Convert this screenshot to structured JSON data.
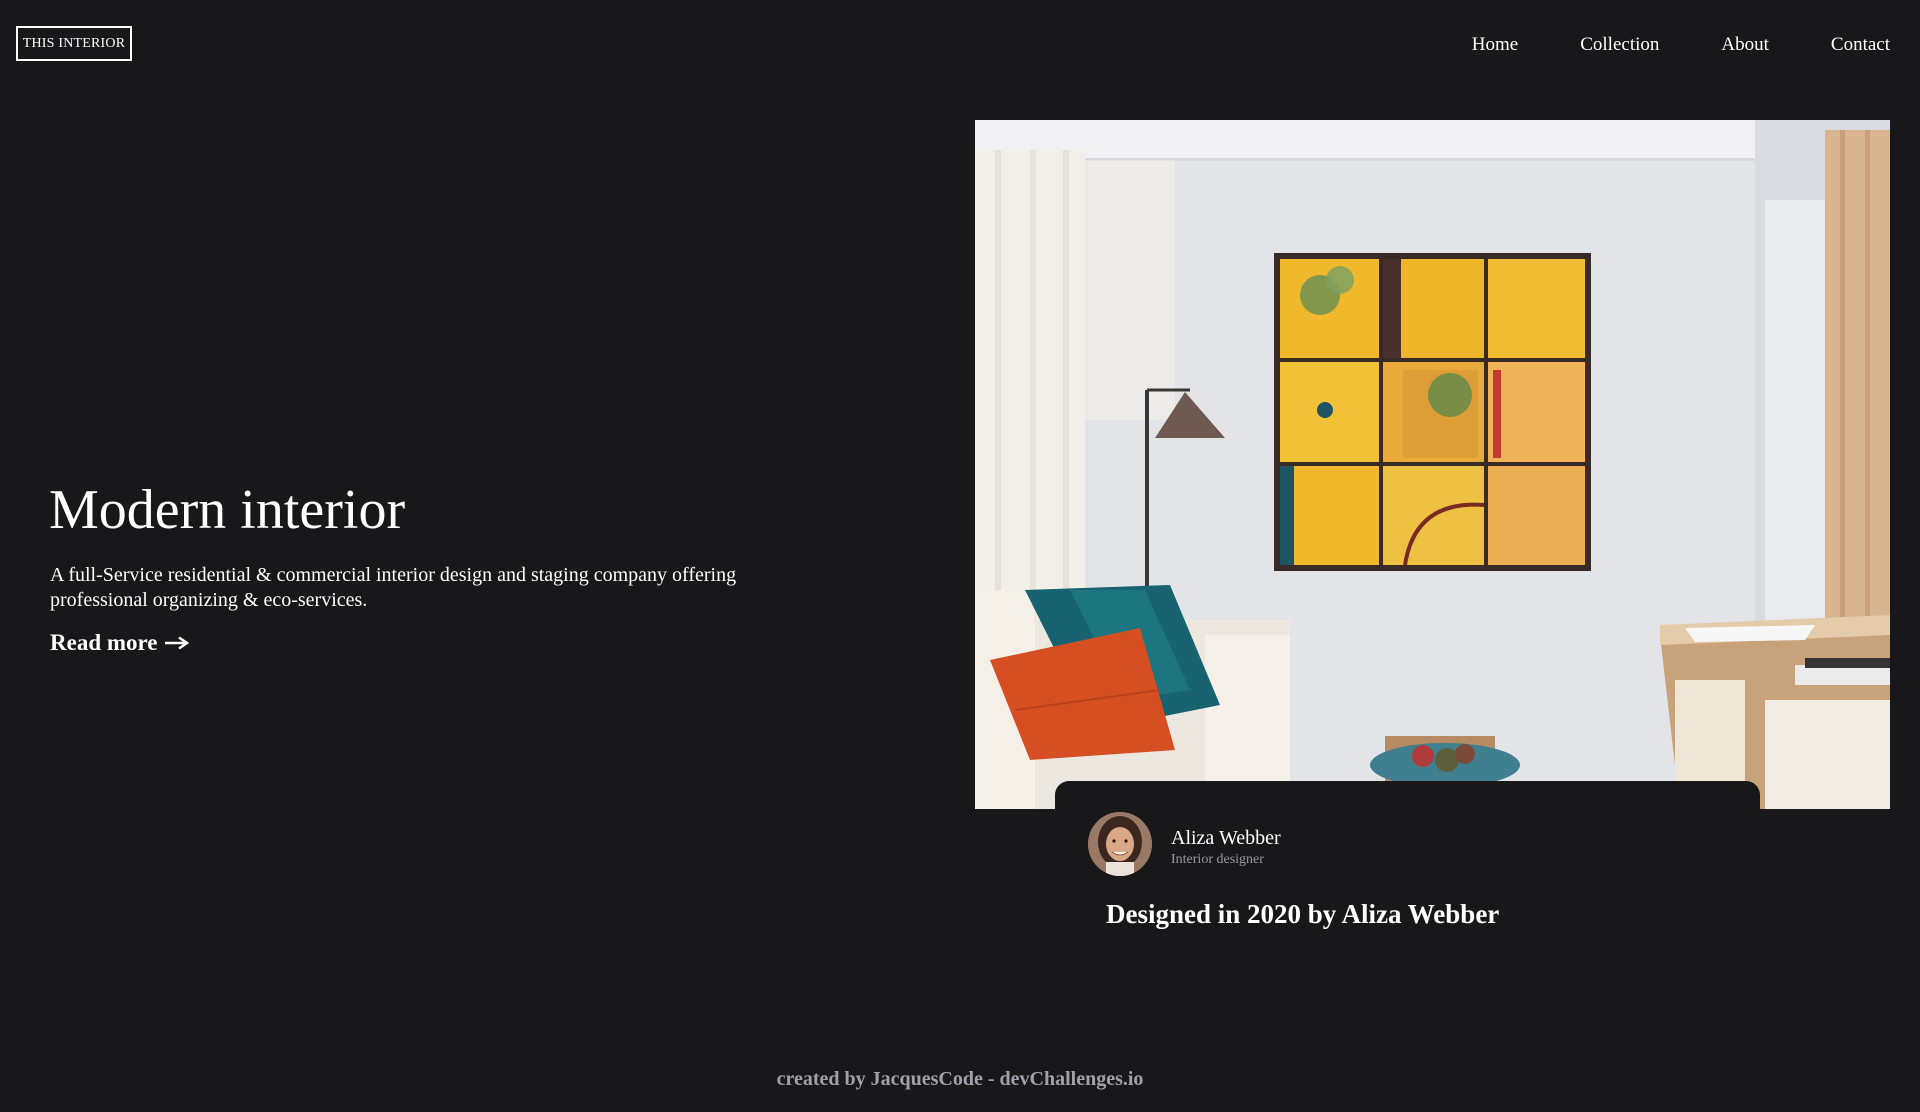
{
  "header": {
    "logo_text": "THIS INTERIOR",
    "nav": [
      {
        "label": "Home"
      },
      {
        "label": "Collection"
      },
      {
        "label": "About"
      },
      {
        "label": "Contact"
      }
    ]
  },
  "hero": {
    "title": "Modern interior",
    "description": "A full-Service residential & commercial interior design and staging company offering professional organizing & eco-services.",
    "read_more_label": "Read more",
    "read_more_icon": "arrow-right-icon",
    "image_subject": "living-room-photo"
  },
  "designer": {
    "name": "Aliza Webber",
    "role": "Interior designer",
    "designed_in": "Designed in 2020 by Aliza Webber"
  },
  "footer": {
    "credit": "created by JacquesCode - devChallenges.io"
  },
  "colors": {
    "background": "#18181b",
    "text": "#ffffff",
    "muted": "#a1a1aa"
  }
}
